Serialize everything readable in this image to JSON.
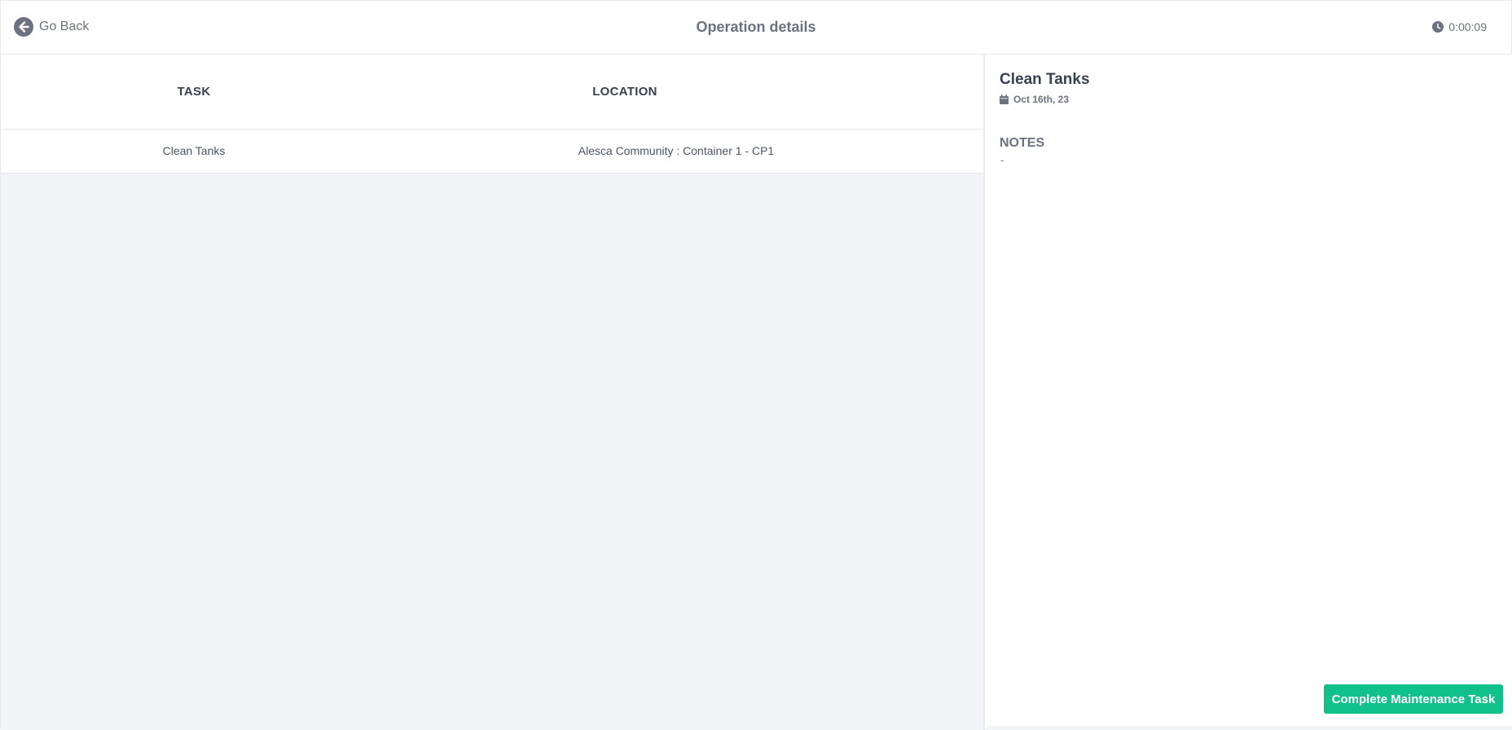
{
  "header": {
    "back_label": "Go Back",
    "title": "Operation details",
    "timer": "0:00:09"
  },
  "table": {
    "columns": [
      "TASK",
      "LOCATION"
    ],
    "rows": [
      {
        "task": "Clean Tanks",
        "location": "Alesca Community : Container 1 - CP1"
      }
    ]
  },
  "detail": {
    "title": "Clean Tanks",
    "date": "Oct 16th, 23",
    "notes_label": "NOTES",
    "notes_value": "-",
    "complete_label": "Complete Maintenance Task"
  },
  "colors": {
    "accent": "#10c28a",
    "muted_text": "#6b7280",
    "pane_background": "#f2f4f8"
  },
  "icons": {
    "back": "arrow-left-circle-icon",
    "timer": "clock-icon",
    "date": "calendar-icon"
  }
}
